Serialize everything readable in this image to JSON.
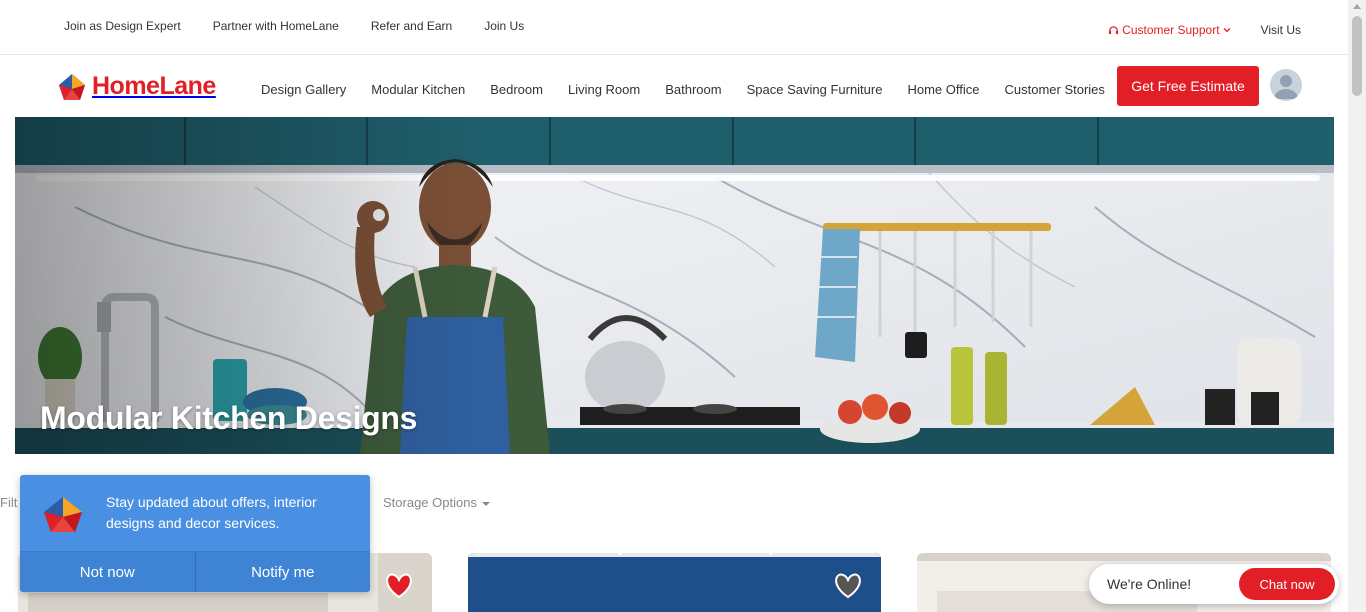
{
  "topbar": {
    "links": [
      "Join as Design Expert",
      "Partner with HomeLane",
      "Refer and Earn",
      "Join Us"
    ],
    "customer_support": "Customer Support",
    "visit_us": "Visit Us"
  },
  "nav": {
    "logo_text": "HomeLane",
    "links": [
      "Design Gallery",
      "Modular Kitchen",
      "Bedroom",
      "Living Room",
      "Bathroom",
      "Space Saving Furniture",
      "Home Office",
      "Customer Stories"
    ],
    "cta_label": "Get Free Estimate"
  },
  "hero": {
    "title": "Modular Kitchen Designs"
  },
  "filters": {
    "label": "Filt",
    "storage_options": "Storage Options"
  },
  "notification": {
    "message": "Stay updated about offers, interior designs and decor services.",
    "not_now": "Not now",
    "notify_me": "Notify me"
  },
  "chat": {
    "status": "We're Online!",
    "button": "Chat now"
  },
  "colors": {
    "brand_red": "#e21e26",
    "notify_blue": "#4a90e2"
  }
}
